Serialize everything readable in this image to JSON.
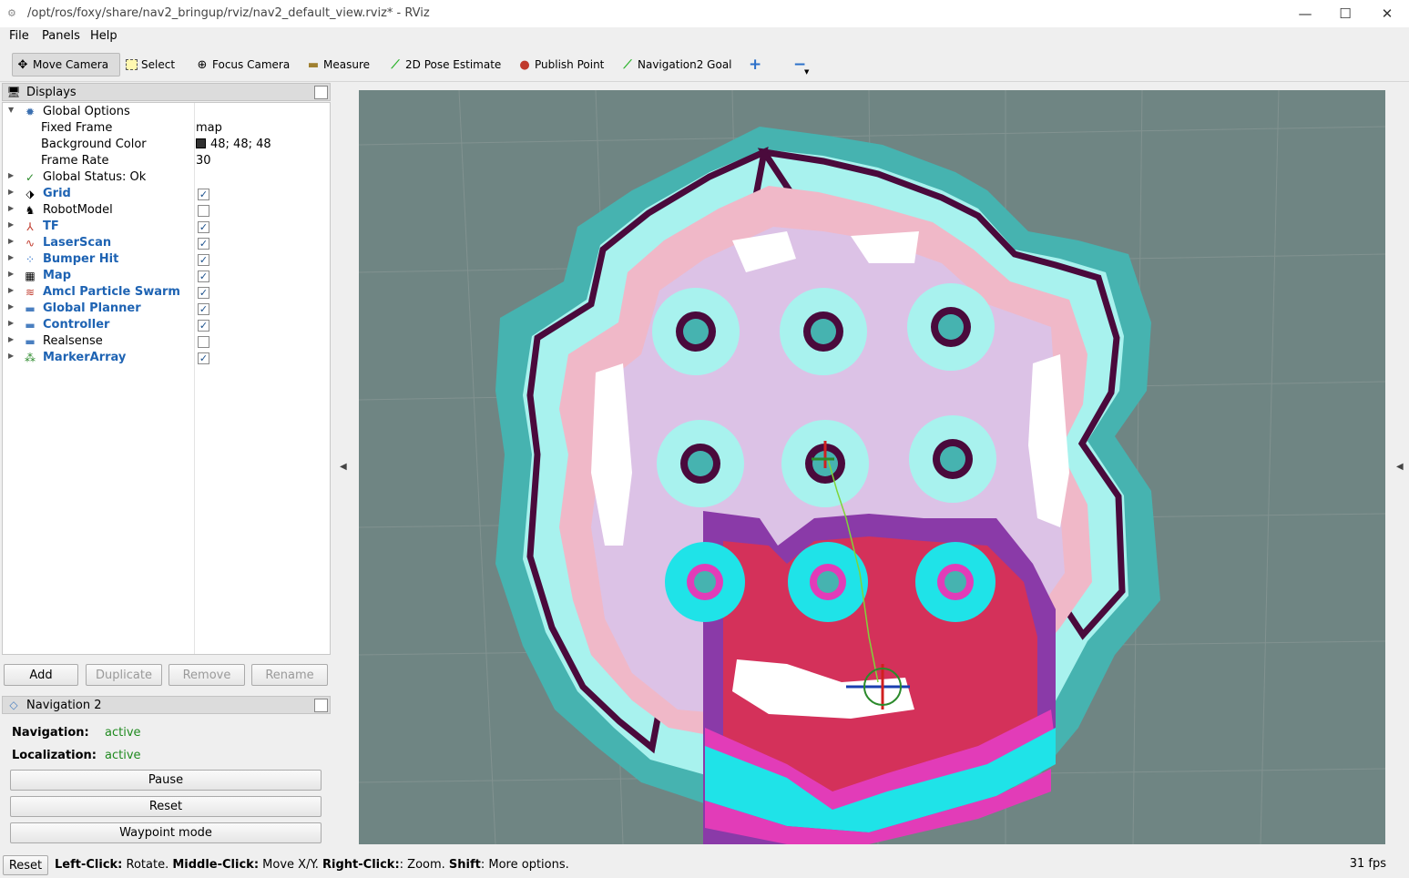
{
  "window": {
    "title": "/opt/ros/foxy/share/nav2_bringup/rviz/nav2_default_view.rviz* - RViz",
    "minimize": "—",
    "maximize": "☐",
    "close": "✕"
  },
  "menu": {
    "file": "File",
    "panels": "Panels",
    "help": "Help"
  },
  "toolbar": {
    "move_camera": "Move Camera",
    "select": "Select",
    "focus_camera": "Focus Camera",
    "measure": "Measure",
    "pose_estimate": "2D Pose Estimate",
    "publish_point": "Publish Point",
    "nav2_goal": "Navigation2 Goal",
    "plus": "+",
    "minus": "−"
  },
  "displays": {
    "title": "Displays",
    "global_options": "Global Options",
    "fixed_frame_label": "Fixed Frame",
    "fixed_frame_value": "map",
    "bg_color_label": "Background Color",
    "bg_color_value": "48; 48; 48",
    "frame_rate_label": "Frame Rate",
    "frame_rate_value": "30",
    "global_status": "Global Status: Ok",
    "items": [
      {
        "label": "Grid",
        "checked": true,
        "icon": "grid-icon"
      },
      {
        "label": "RobotModel",
        "checked": false,
        "icon": "robot-icon"
      },
      {
        "label": "TF",
        "checked": true,
        "icon": "tf-icon"
      },
      {
        "label": "LaserScan",
        "checked": true,
        "icon": "laser-icon"
      },
      {
        "label": "Bumper Hit",
        "checked": true,
        "icon": "points-icon"
      },
      {
        "label": "Map",
        "checked": true,
        "icon": "map-icon"
      },
      {
        "label": "Amcl Particle Swarm",
        "checked": true,
        "icon": "arrows-icon"
      },
      {
        "label": "Global Planner",
        "checked": true,
        "icon": "folder-icon"
      },
      {
        "label": "Controller",
        "checked": true,
        "icon": "folder-icon"
      },
      {
        "label": "Realsense",
        "checked": false,
        "icon": "folder-icon"
      },
      {
        "label": "MarkerArray",
        "checked": true,
        "icon": "markers-icon"
      }
    ],
    "buttons": {
      "add": "Add",
      "duplicate": "Duplicate",
      "remove": "Remove",
      "rename": "Rename"
    }
  },
  "nav2": {
    "title": "Navigation 2",
    "navigation_label": "Navigation:",
    "navigation_value": "active",
    "localization_label": "Localization:",
    "localization_value": "active",
    "pause": "Pause",
    "reset": "Reset",
    "waypoint": "Waypoint mode"
  },
  "status": {
    "reset": "Reset",
    "hint_1": "Left-Click:",
    "hint_2": " Rotate. ",
    "hint_3": "Middle-Click:",
    "hint_4": " Move X/Y. ",
    "hint_5": "Right-Click:",
    "hint_6": ": Zoom. ",
    "hint_7": "Shift",
    "hint_8": ": More options.",
    "fps": "31 fps"
  },
  "colors": {
    "viewport_bg": "#6f8583",
    "costmap_teal": "#46b3b0",
    "costmap_cyan": "#a8f2ee",
    "costmap_pink": "#f0b8c8",
    "costmap_lilac": "#dcc2e6",
    "obstacle": "#4a0a3c",
    "local_magenta": "#e23cb8",
    "local_red": "#e0304c",
    "local_purple": "#8a3aa8"
  }
}
